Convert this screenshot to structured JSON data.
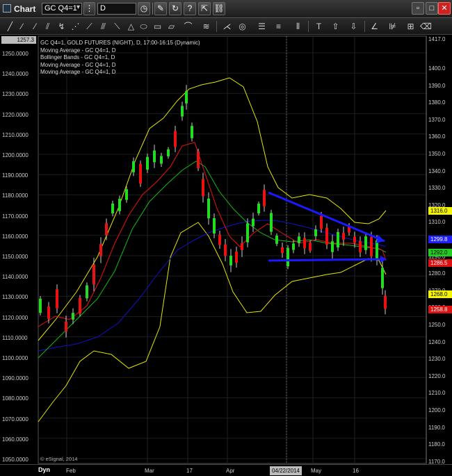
{
  "window": {
    "title": "Chart",
    "symbol": "GC Q4=1",
    "interval": "D"
  },
  "chart": {
    "legend": [
      "GC Q4=1, GOLD FUTURES (NIGHT), D, 17:00-16:15 (Dynamic)",
      "Moving Average - GC Q4=1, D",
      "Bollinger Bands - GC Q4=1, D",
      "Moving Average - GC Q4=1, D",
      "Moving Average - GC Q4=1, D"
    ],
    "watermark": "© eSignal, 2014",
    "left_axis_top": "1257.3",
    "right_axis_top": "1417.0",
    "left_axis": [
      "1250.0000",
      "1240.0000",
      "1230.0000",
      "1220.0000",
      "1210.0000",
      "1200.0000",
      "1190.0000",
      "1180.0000",
      "1170.0000",
      "1160.0000",
      "1150.0000",
      "1140.0000",
      "1130.0000",
      "1120.0000",
      "1110.0000",
      "1100.0000",
      "1090.0000",
      "1080.0000",
      "1070.0000",
      "1060.0000",
      "1050.0000"
    ],
    "right_axis": [
      "1400.0",
      "1390.0",
      "1380.0",
      "1370.0",
      "1360.0",
      "1350.0",
      "1340.0",
      "1330.0",
      "1320.0",
      "1310.0",
      "1300.0",
      "1290.0",
      "1280.0",
      "1270.0",
      "1260.0",
      "1250.0",
      "1240.0",
      "1230.0",
      "1220.0",
      "1210.0",
      "1200.0",
      "1190.0",
      "1180.0",
      "1170.0"
    ],
    "price_tags": [
      {
        "label": "1316.0",
        "bg": "#f5f500",
        "fg": "#000"
      },
      {
        "label": "1299.8",
        "bg": "#2020ff",
        "fg": "#fff"
      },
      {
        "label": "1292.0",
        "bg": "#22cc22",
        "fg": "#000"
      },
      {
        "label": "1286.5",
        "bg": "#dd1111",
        "fg": "#fff"
      },
      {
        "label": "1268.0",
        "bg": "#f5f500",
        "fg": "#000"
      },
      {
        "label": "1258.8",
        "bg": "#dd1111",
        "fg": "#fff"
      }
    ],
    "x_axis": {
      "mode": "Dyn",
      "labels": [
        "Feb",
        "Mar",
        "17",
        "Apr",
        "May",
        "16"
      ],
      "cursor_date": "04/22/2014"
    },
    "colors": {
      "up": "#22dd22",
      "down": "#ee1111",
      "ma_fast": "#ee1111",
      "ma_mid": "#11bb11",
      "ma_slow": "#1111cc",
      "bollinger": "#e6e600",
      "trend": "#1a1aff"
    }
  }
}
